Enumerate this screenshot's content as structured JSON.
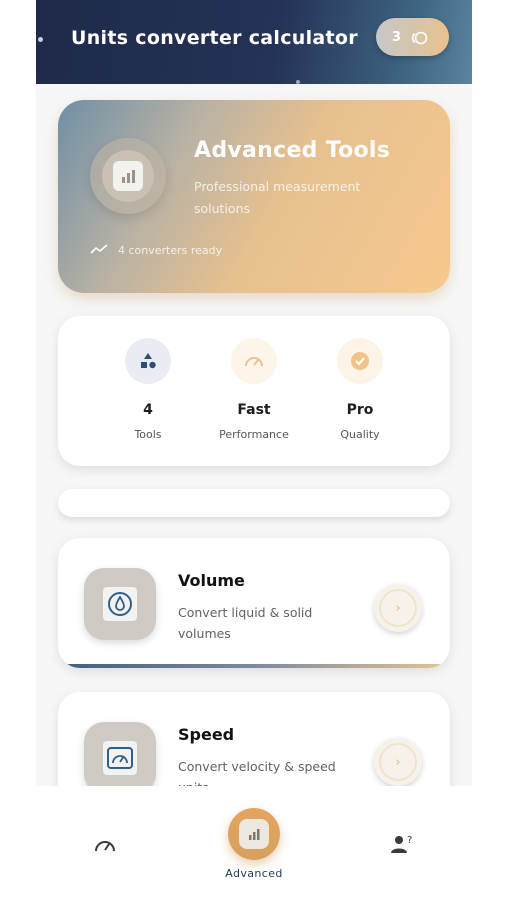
{
  "header": {
    "title": "Units converter calculator",
    "badge_count": "3",
    "badge_icon": "coin-icon"
  },
  "hero": {
    "title": "Advanced Tools",
    "subtitle": "Professional measurement solutions",
    "status": "4 converters ready",
    "icon": "document-chart-icon",
    "status_icon": "trend-icon"
  },
  "stats": [
    {
      "value": "4",
      "label": "Tools",
      "icon": "shapes-icon"
    },
    {
      "value": "Fast",
      "label": "Performance",
      "icon": "speedometer-icon"
    },
    {
      "value": "Pro",
      "label": "Quality",
      "icon": "check-badge-icon"
    }
  ],
  "cards": [
    {
      "title": "Volume",
      "subtitle": "Convert liquid & solid volumes",
      "icon": "droplet-icon"
    },
    {
      "title": "Speed",
      "subtitle": "Convert velocity & speed units",
      "icon": "gauge-icon"
    }
  ],
  "nav": {
    "center_label": "Advanced",
    "items": [
      "speedometer-icon",
      "document-chart-icon",
      "user-question-icon"
    ]
  },
  "colors": {
    "header_dark": "#1f2a4a",
    "accent_orange": "#f7c98e",
    "text_dark": "#121216",
    "nav_label": "#1f3a5c"
  }
}
